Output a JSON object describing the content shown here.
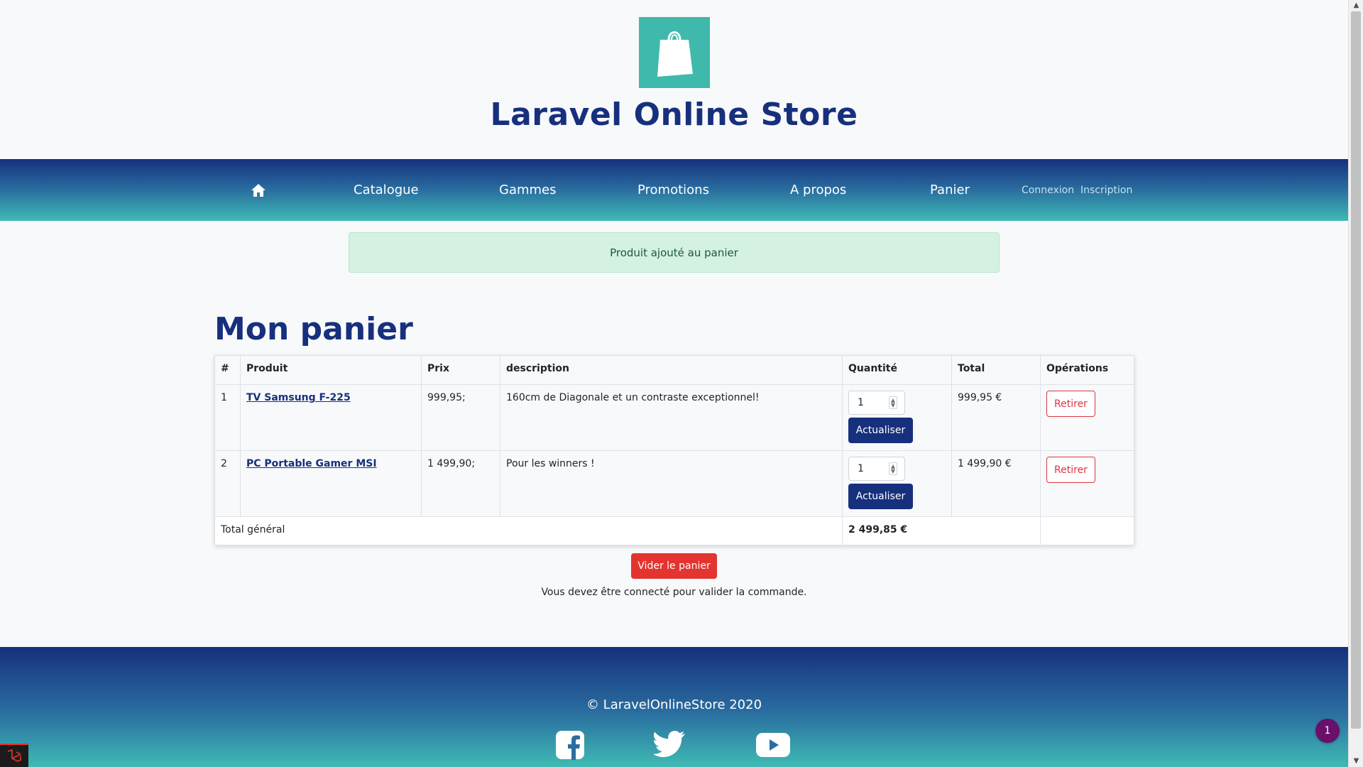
{
  "header": {
    "title": "Laravel Online Store"
  },
  "nav": {
    "home_icon": "home-icon",
    "items": [
      "Catalogue",
      "Gammes",
      "Promotions",
      "A propos",
      "Panier"
    ],
    "auth": [
      "Connexion",
      "Inscription"
    ]
  },
  "alert": {
    "message": "Produit ajouté au panier"
  },
  "cart": {
    "title": "Mon panier",
    "columns": [
      "#",
      "Produit",
      "Prix",
      "description",
      "Quantité",
      "Total",
      "Opérations"
    ],
    "rows": [
      {
        "num": "1",
        "product": "TV Samsung F-225",
        "price": "999,95;",
        "description": "160cm de Diagonale et un contraste exceptionnel!",
        "quantity": "1",
        "total": "999,95 €"
      },
      {
        "num": "2",
        "product": "PC Portable Gamer MSI",
        "price": "1 499,90;",
        "description": "Pour les winners !",
        "quantity": "1",
        "total": "1 499,90 €"
      }
    ],
    "update_label": "Actualiser",
    "remove_label": "Retirer",
    "grand_total_label": "Total général",
    "grand_total_value": "2 499,85 €",
    "empty_label": "Vider le panier",
    "login_note": "Vous devez être connecté pour valider la commande."
  },
  "footer": {
    "copyright": "© LaravelOnlineStore 2020",
    "social": [
      "facebook-icon",
      "twitter-icon",
      "youtube-icon"
    ]
  },
  "badge": {
    "count": "1"
  },
  "colors": {
    "primary": "#17307d",
    "accent": "#3fb9ac",
    "danger": "#e3342f",
    "alert_bg": "#d4f1e1"
  }
}
